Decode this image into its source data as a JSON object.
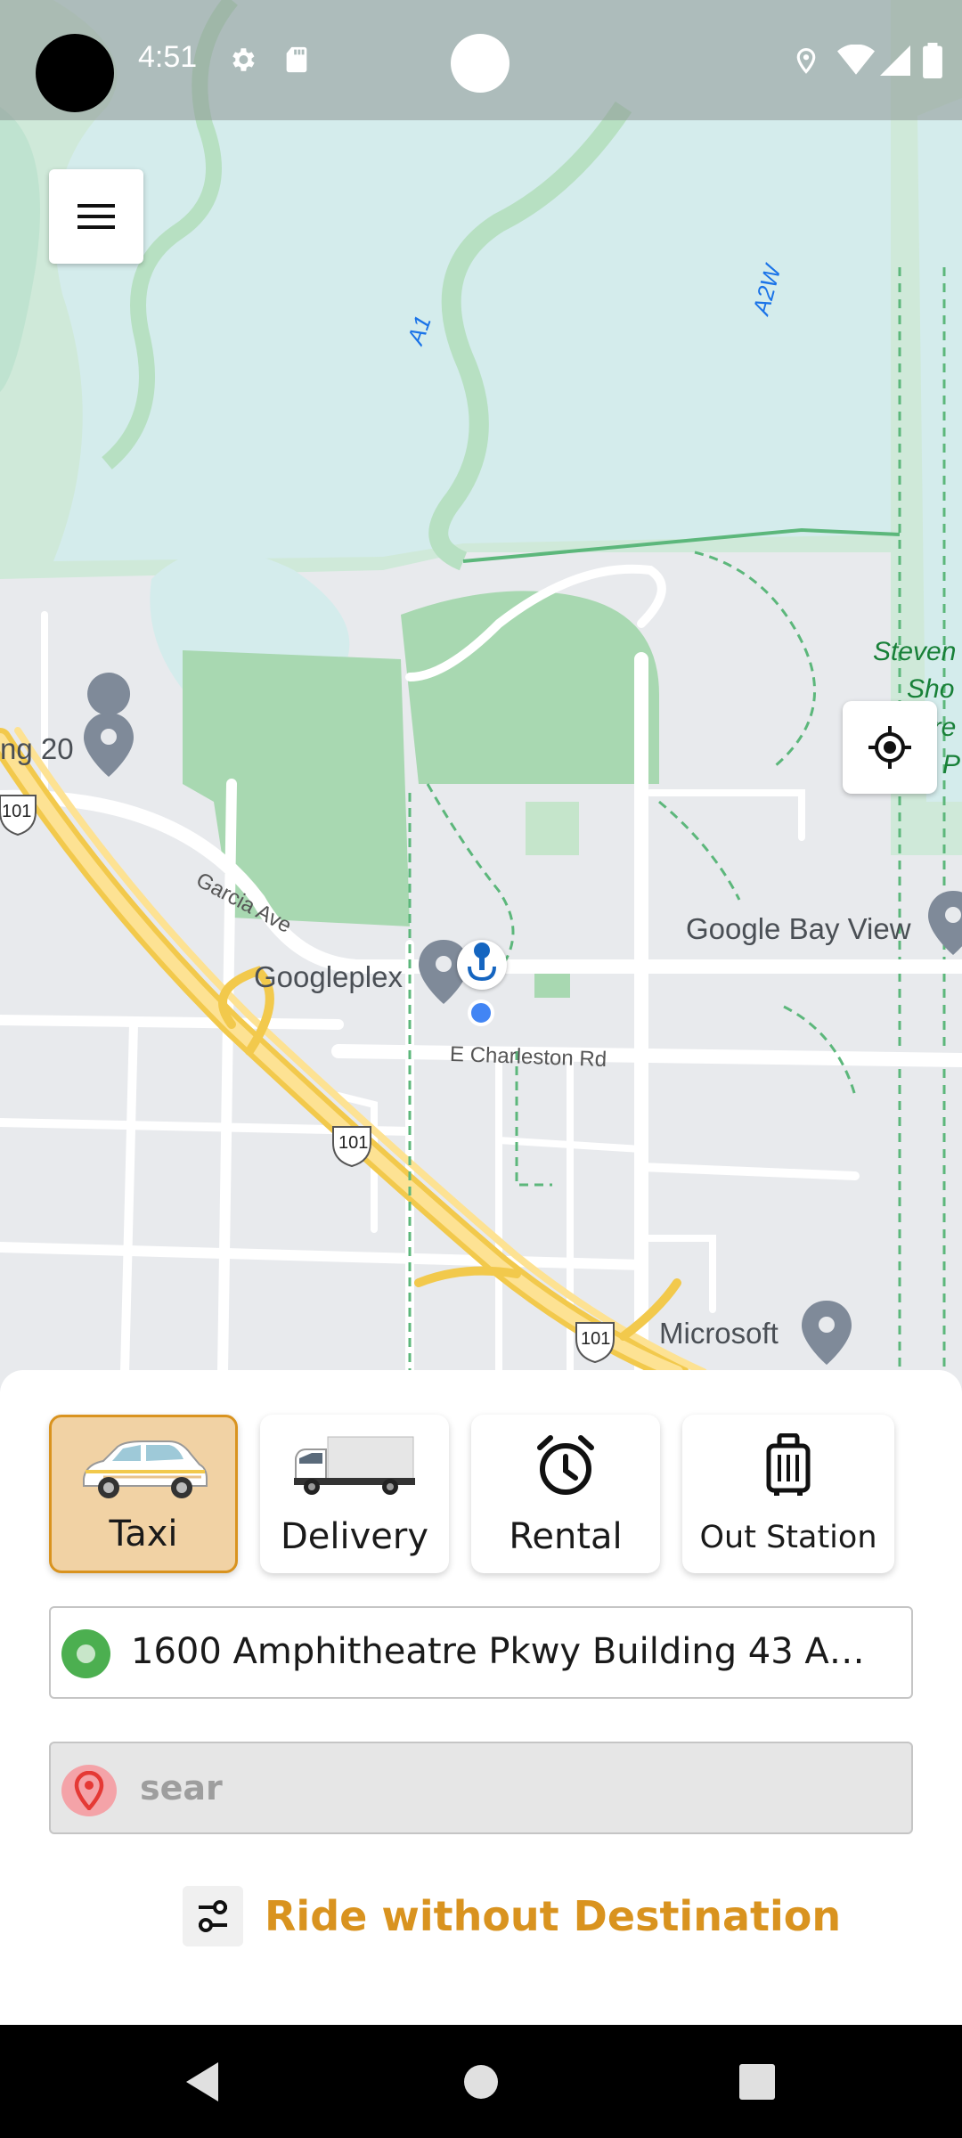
{
  "status_bar": {
    "time": "4:51",
    "icons": [
      "settings-icon",
      "sd-card-icon",
      "location-icon",
      "wifi-icon",
      "signal-icon",
      "battery-icon"
    ]
  },
  "map": {
    "labels": {
      "googleplex": "Googleplex",
      "google_bay_view": "Google Bay View",
      "microsoft": "Microsoft",
      "building_20": "ng 20",
      "garcia_ave": "Garcia Ave",
      "e_charleston": "E Charleston Rd",
      "a1": "A1",
      "a2w": "A2W",
      "hwy_101_a": "101",
      "hwy_101_b": "101",
      "hwy_101_c": "101",
      "stevens_1": "Steven",
      "stevens_2": "Sho",
      "stevens_3": "ure",
      "stevens_4": "P"
    }
  },
  "services": [
    {
      "label": "Taxi",
      "icon": "taxi-icon",
      "selected": true
    },
    {
      "label": "Delivery",
      "icon": "truck-icon",
      "selected": false
    },
    {
      "label": "Rental",
      "icon": "alarm-clock-icon",
      "selected": false
    },
    {
      "label": "Out Station",
      "icon": "luggage-icon",
      "selected": false
    }
  ],
  "pickup": {
    "value": "1600 Amphitheatre Pkwy Building 43 Amp..."
  },
  "destination": {
    "value": "sear"
  },
  "ride_without_destination": "Ride without Destination",
  "colors": {
    "accent": "#d9931f",
    "selected_bg": "#f1d2a4",
    "pickup_dot": "#4caf50",
    "dest_pin": "#e53935"
  }
}
